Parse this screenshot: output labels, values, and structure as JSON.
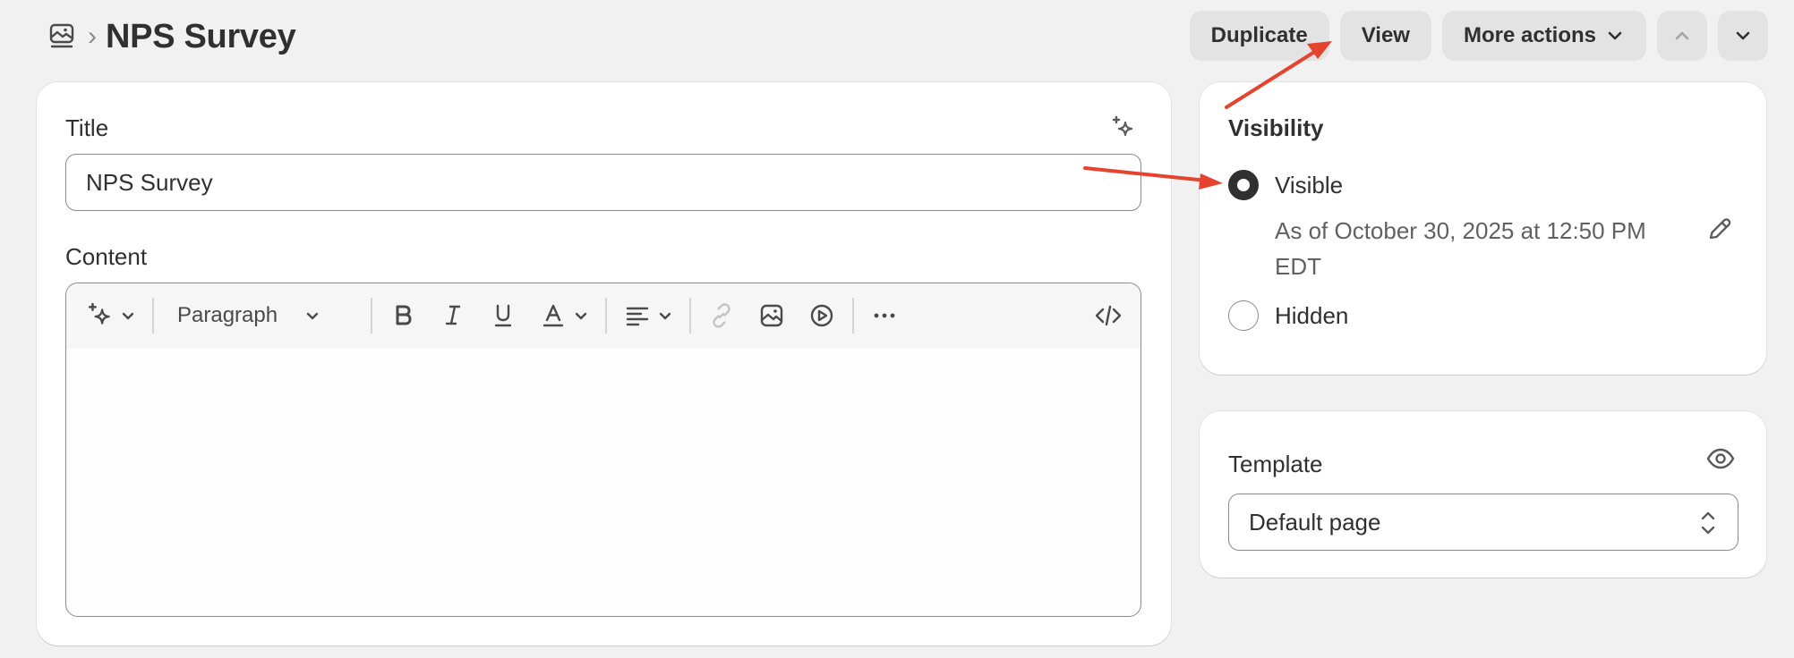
{
  "header": {
    "breadcrumb_icon": "pages-icon",
    "breadcrumb_separator": "›",
    "title": "NPS Survey",
    "actions": {
      "duplicate": "Duplicate",
      "view": "View",
      "more_actions": "More actions"
    }
  },
  "main": {
    "title_label": "Title",
    "title_value": "NPS Survey",
    "content_label": "Content",
    "toolbar": {
      "block_style": "Paragraph",
      "icons": [
        "sparkle-icon",
        "bold-icon",
        "italic-icon",
        "underline-icon",
        "text-color-icon",
        "align-icon",
        "link-icon",
        "image-icon",
        "video-icon",
        "more-icon",
        "code-icon"
      ]
    }
  },
  "visibility": {
    "heading": "Visibility",
    "options": [
      {
        "label": "Visible",
        "selected": true
      },
      {
        "label": "Hidden",
        "selected": false
      }
    ],
    "visible_date": "As of October 30, 2025 at 12:50 PM EDT"
  },
  "template": {
    "label": "Template",
    "selected": "Default page"
  },
  "colors": {
    "background": "#f1f1f1",
    "card": "#ffffff",
    "button": "#e3e3e3",
    "text": "#303030",
    "muted_text": "#616161",
    "annotation_arrow": "#e5432d"
  }
}
